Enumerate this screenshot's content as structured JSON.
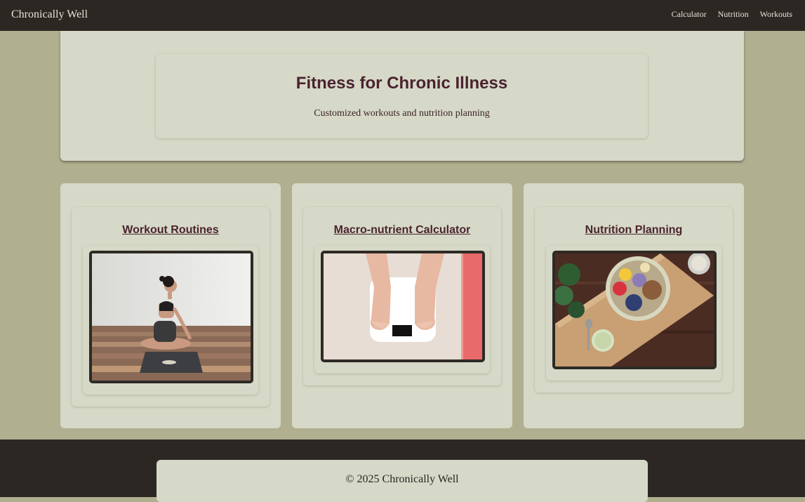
{
  "nav": {
    "brand": "Chronically Well",
    "links": [
      "Calculator",
      "Nutrition",
      "Workouts"
    ]
  },
  "hero": {
    "title": "Fitness for Chronic Illness",
    "subtitle": "Customized workouts and nutrition planning"
  },
  "cards": [
    {
      "title": "Workout Routines",
      "image": "woman-meditating-on-yoga-mat-photo"
    },
    {
      "title": "Macro-nutrient Calculator",
      "image": "feet-on-bathroom-scale-photo"
    },
    {
      "title": "Nutrition Planning",
      "image": "smoothie-bowl-on-cutting-board-photo"
    }
  ],
  "footer": {
    "copyright": "© 2025 Chronically Well"
  },
  "colors": {
    "nav_bg": "#2d2724",
    "page_bg": "#b0af8f",
    "card_bg": "#d6d9c7",
    "heading": "#4a2330"
  }
}
